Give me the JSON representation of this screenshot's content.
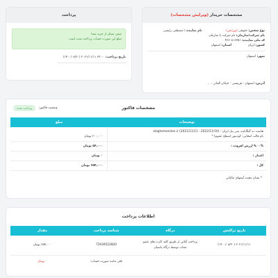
{
  "buyer": {
    "title": "مشخصات خریدار",
    "title_edit": "(ویرایش مشخصات)",
    "person_type_label": "نوع شخص:",
    "person_type_value": "حقوقی",
    "person_type_edit": "(ویرایش)",
    "rep_label": "نام نماینده :",
    "rep_value": "مصطفی رئیسی",
    "company_label": "نام شرکت/سازمان:",
    "company_value": "نام شرکت یا سازمان",
    "code_label": "کد ملی نماینده:",
    "code_value": "۴۶۶۰۸۱۶۳۵۱",
    "country_label": "کشور:",
    "country_value": "ایران",
    "province_label": "استان:",
    "province_value": "اصفهان",
    "city_label": "شهر:",
    "city_value": "اصفهان",
    "address_label": "آدرس:",
    "address_value": "اصفهان - فریشتی - خیابان القادر - ..."
  },
  "payment": {
    "title": "پرداخت",
    "alert_line1": "ضمن تشکر از خرید شما",
    "alert_line2": "مبلغ این صورت حساب پرداخت شده است.",
    "date_label": "تاریخ پرداخت:",
    "date_value": "۲۲:۰۰ ۲۰۲۱/۱۱/۱۱ (۱۴۰۰/۰۸/۲۰)"
  },
  "invoice": {
    "title": "مشخصات فاکتور",
    "status_label": "وضعیت فاکتور:",
    "status_value": "پرداخت شده",
    "col_desc": "توضیحات",
    "col_amount": "مبلغ",
    "item_line1": "هاست ده گیگابایت سی پنل ایران - alaghemandan.ir (2021/11/11 - 2022/11/10)",
    "item_line2": "نام قالب انتخابی: کودنتور (سطح عموم) *",
    "item_amount": "۶۰۰,۰۰۰ تومان",
    "vat_label": "۹.۰۰% ارزش افزوده :",
    "vat_amount": "۵۴,۰۰۰ تومان",
    "credit_label": "اعتبار :",
    "credit_amount": "۰ تومان",
    "total_label": "کل :",
    "total_amount": "۶۵۴,۰۰۰ تومان",
    "note": "* نشان دهنده آیتمهای مالیاتی"
  },
  "payinfo": {
    "title": "اطلاعات پرداخت",
    "headers": [
      "تاریخ تراکنش",
      "درگاه",
      "شناسه پرداخت",
      "مقدار"
    ],
    "date": "۲۰۲۱/۱۱/۱۱ (۱۴۰۰/۰۸/۲۰)",
    "gateway_line1": "پرداخت آنلاین از طریق کلیه کارت های عضو",
    "gateway_line2": "شتاب توسط درگاه پاسیان",
    "tx_id": "72939522820",
    "amount": "۶۵۴,۰۰۰ تومان",
    "balance_label": "باقی مانده صورت حساب:",
    "balance_value": "۰ تومان"
  }
}
